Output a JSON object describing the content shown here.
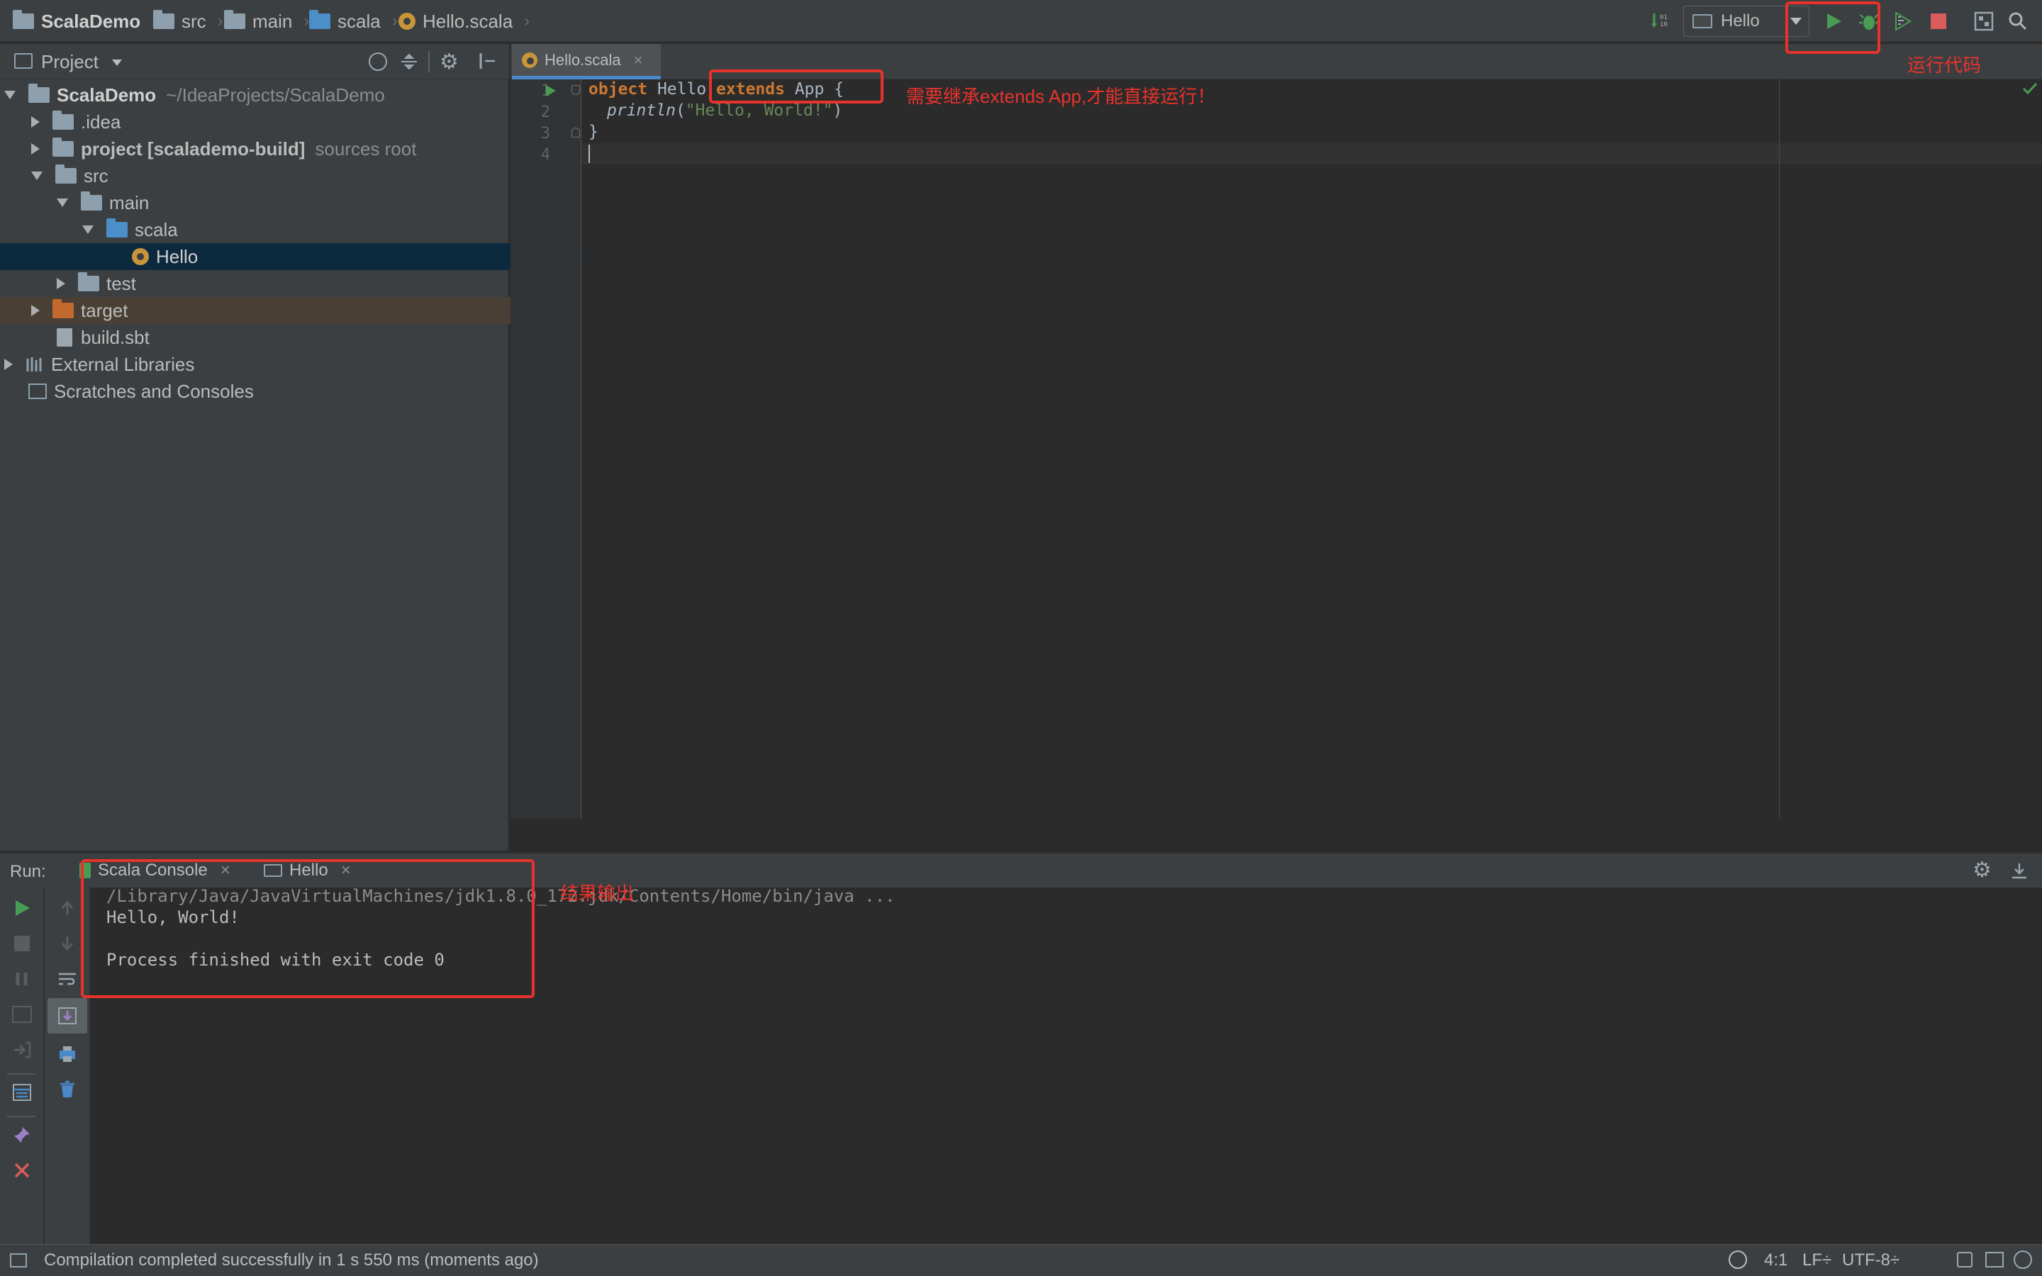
{
  "breadcrumb": [
    "ScalaDemo",
    "src",
    "main",
    "scala",
    "Hello.scala"
  ],
  "toolbar": {
    "run_config": "Hello"
  },
  "project_panel": {
    "title": "Project",
    "tree": [
      {
        "label": "ScalaDemo",
        "extra": "~/IdeaProjects/ScalaDemo"
      },
      {
        "label": ".idea"
      },
      {
        "label": "project [scalademo-build]",
        "extra": "sources root"
      },
      {
        "label": "src"
      },
      {
        "label": "main"
      },
      {
        "label": "scala"
      },
      {
        "label": "Hello"
      },
      {
        "label": "test"
      },
      {
        "label": "target"
      },
      {
        "label": "build.sbt"
      },
      {
        "label": "External Libraries"
      },
      {
        "label": "Scratches and Consoles"
      }
    ]
  },
  "editor": {
    "tab_label": "Hello.scala",
    "line_numbers": [
      "1",
      "2",
      "3",
      "4"
    ],
    "code": {
      "l1_kw": "object",
      "l1_name": " Hello ",
      "l1_kw2": "extends",
      "l1_rest": " App {",
      "l2_fn": "println",
      "l2_open": "(",
      "l2_str": "\"Hello, World!\"",
      "l2_close": ")",
      "l3": "}"
    }
  },
  "annotations": {
    "extends_note": "需要继承extends App,才能直接运行！",
    "run_note": "运行代码",
    "output_note": "结果输出"
  },
  "run_panel": {
    "label": "Run:",
    "tabs": [
      "Scala Console",
      "Hello"
    ],
    "output": [
      "/Library/Java/JavaVirtualMachines/jdk1.8.0_172.jdk/Contents/Home/bin/java ...",
      "Hello, World!",
      "",
      "Process finished with exit code 0"
    ]
  },
  "status_bar": {
    "message": "Compilation completed successfully in 1 s 550 ms (moments ago)",
    "position": "4:1",
    "line_sep": "LF÷",
    "encoding": "UTF-8÷"
  },
  "colors": {
    "accent_red": "#e8322b",
    "run_green": "#499c54",
    "keyword": "#cc7832",
    "string": "#6a8759"
  },
  "icons": [
    "folder-icon",
    "scala-object-icon",
    "run-icon",
    "debug-icon",
    "coverage-icon",
    "stop-icon",
    "search-icon",
    "gear-icon",
    "close-icon"
  ]
}
